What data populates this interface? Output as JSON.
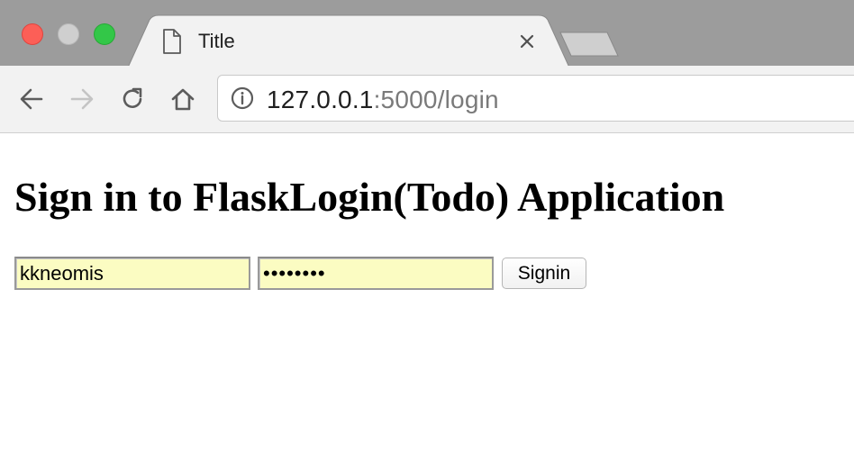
{
  "browser": {
    "tab": {
      "title": "Title",
      "icon": "document-icon"
    },
    "window_controls": [
      "close",
      "minimize",
      "maximize"
    ],
    "address_bar": {
      "url_host": "127.0.0.1",
      "url_rest": ":5000/login",
      "info_icon": "info-icon"
    },
    "nav": {
      "back_icon": "arrow-left-icon",
      "forward_icon": "arrow-right-icon",
      "reload_icon": "reload-icon",
      "home_icon": "home-icon"
    }
  },
  "page": {
    "heading": "Sign in to FlaskLogin(Todo) Application",
    "form": {
      "username_value": "kkneomis",
      "password_value": "••••••••",
      "submit_label": "Signin"
    }
  },
  "colors": {
    "tabstrip": "#9c9c9c",
    "toolbar": "#f2f2f2",
    "autofill": "#fbfcc2",
    "traffic_close": "#fc5f57",
    "traffic_max": "#33c748"
  }
}
